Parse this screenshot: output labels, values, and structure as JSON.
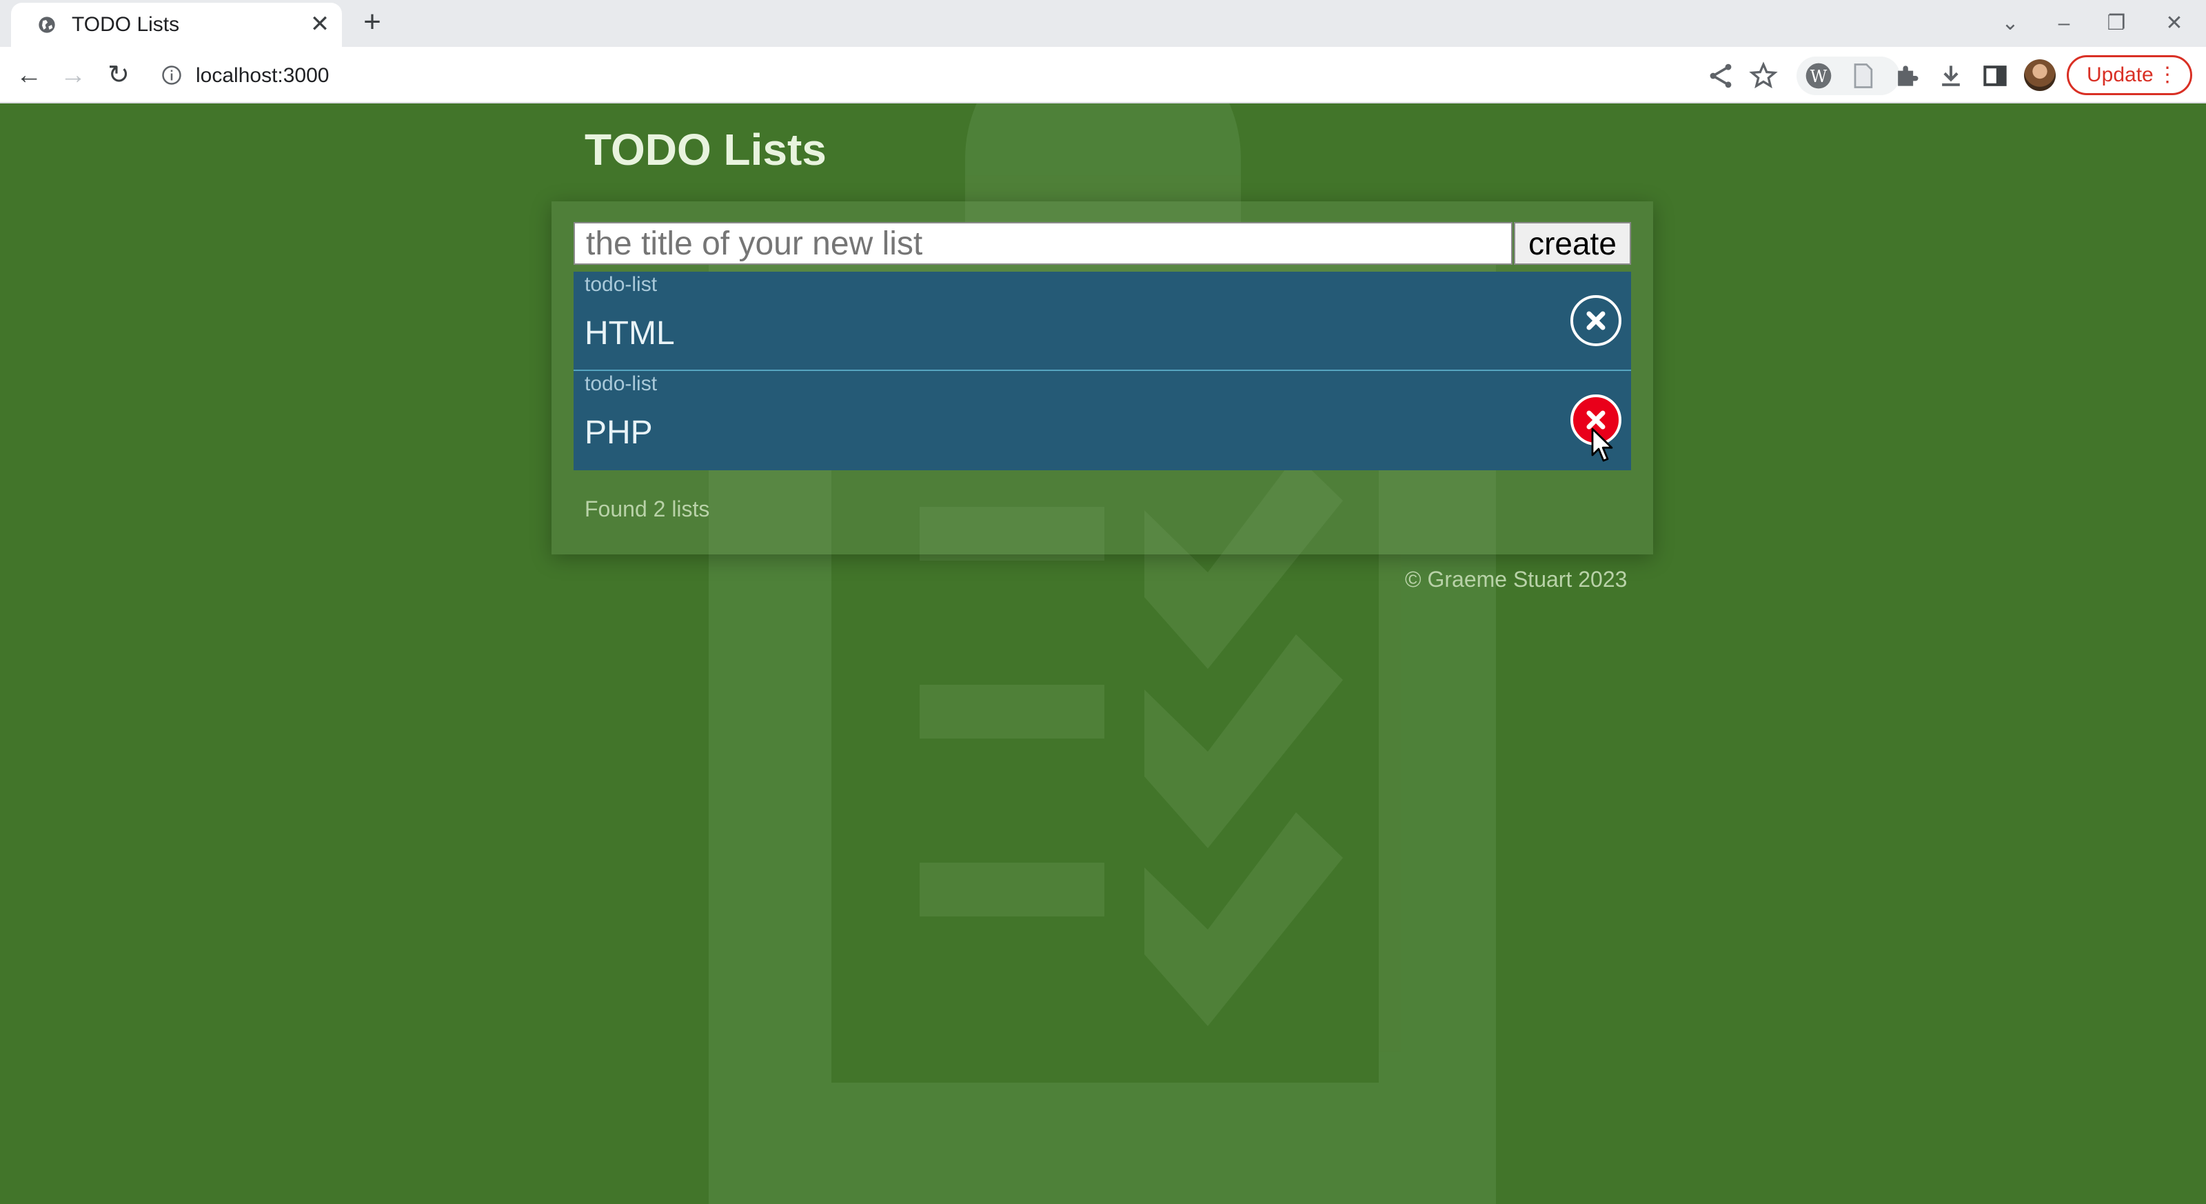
{
  "browser": {
    "tab_title": "TODO Lists",
    "tab_close_glyph": "✕",
    "new_tab_glyph": "+",
    "url": "localhost:3000",
    "update_label": "Update",
    "icons": [
      "back-icon",
      "forward-icon",
      "reload-icon",
      "info-icon",
      "share-icon",
      "star-icon",
      "wordpress-extension-icon",
      "document-extension-icon",
      "puzzle-extensions-icon",
      "download-icon",
      "side-panel-icon",
      "profile-avatar",
      "menu-dots-icon"
    ]
  },
  "app": {
    "title": "TODO Lists",
    "new_list": {
      "placeholder": "the title of your new list",
      "value": "",
      "create_label": "create"
    },
    "lists": [
      {
        "kind": "todo-list",
        "title": "HTML",
        "delete_hovered": false
      },
      {
        "kind": "todo-list",
        "title": "PHP",
        "delete_hovered": true
      }
    ],
    "status": "Found 2 lists",
    "footer": "© Graeme Stuart 2023"
  },
  "colors": {
    "page_background": "#42752a",
    "row_background": "#255a76",
    "delete_hover": "#e9001a",
    "update_accent": "#d93025"
  }
}
